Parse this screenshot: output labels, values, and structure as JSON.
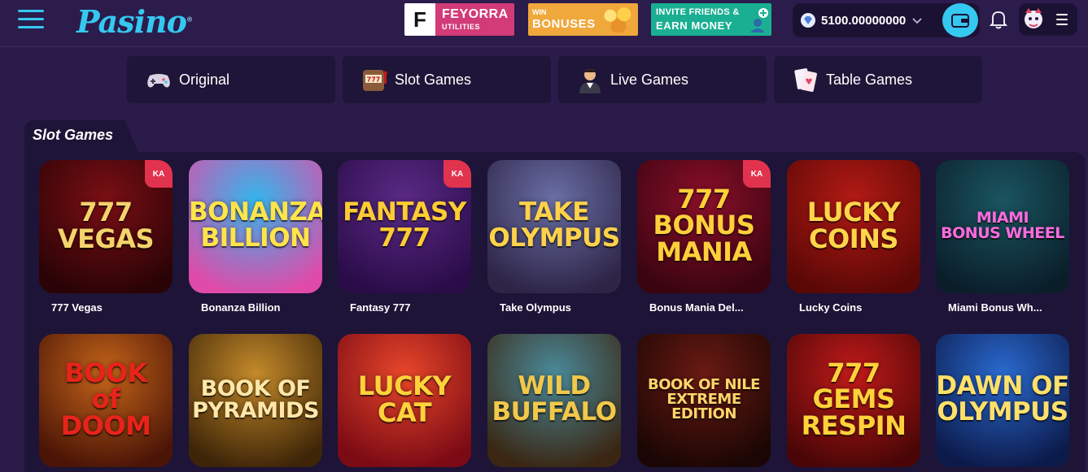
{
  "brand": {
    "logo": "Pasino"
  },
  "promos": {
    "feyorra": {
      "title": "FEYORRA",
      "subtitle": "UTILITIES"
    },
    "bonus": {
      "small": "WIN",
      "big": "BONUSES"
    },
    "invite": {
      "small": "INVITE FRIENDS &",
      "big": "EARN MONEY"
    }
  },
  "wallet": {
    "balance": "5100.00000000"
  },
  "categories": [
    {
      "label": "Original",
      "icon": "gamepad-icon"
    },
    {
      "label": "Slot Games",
      "icon": "slot-machine-icon"
    },
    {
      "label": "Live Games",
      "icon": "dealer-icon"
    },
    {
      "label": "Table Games",
      "icon": "cards-icon"
    }
  ],
  "section": {
    "title": "Slot Games"
  },
  "games": [
    {
      "name": "777 Vegas",
      "art": "777\nVEGAS",
      "colors": [
        "#7a0f14",
        "#2a0306"
      ],
      "text": "#f4d36b",
      "badge": true
    },
    {
      "name": "Bonanza Billion",
      "art": "BONANZA\nBILLION",
      "colors": [
        "#34b6ec",
        "#e04aa8"
      ],
      "text": "#ffe44a",
      "badge": false
    },
    {
      "name": "Fantasy 777",
      "art": "FANTASY\n777",
      "colors": [
        "#5a2a86",
        "#2a0c48"
      ],
      "text": "#ffcc33",
      "badge": true
    },
    {
      "name": "Take Olympus",
      "art": "TAKE\nOLYMPUS",
      "colors": [
        "#6a6fa6",
        "#2d2446"
      ],
      "text": "#ffd24a",
      "badge": false
    },
    {
      "name": "Bonus Mania Del...",
      "art": "777\nBONUS\nMANIA",
      "colors": [
        "#8a0f2a",
        "#3a0410"
      ],
      "text": "#ffcf3a",
      "badge": true
    },
    {
      "name": "Lucky Coins",
      "art": "LUCKY\nCOINS",
      "colors": [
        "#b31a14",
        "#5a0806"
      ],
      "text": "#ffd54a",
      "badge": false
    },
    {
      "name": "Miami Bonus Wh...",
      "art": "MIAMI\nBONUS WHEEL",
      "colors": [
        "#1a5560",
        "#0a1e2a"
      ],
      "text": "#ff6adf",
      "badge": false
    },
    {
      "name": "Book of Doom",
      "art": "BOOK\nof\nDOOM",
      "colors": [
        "#c4641a",
        "#4a1406"
      ],
      "text": "#e8231a",
      "badge": false
    },
    {
      "name": "Book of Pyramids",
      "art": "BOOK OF\nPYRAMIDS",
      "colors": [
        "#c48a2a",
        "#3e2508"
      ],
      "text": "#ffe7a8",
      "badge": false
    },
    {
      "name": "Lucky Cat",
      "art": "LUCKY\nCAT",
      "colors": [
        "#e8462a",
        "#7a0a14"
      ],
      "text": "#ffd23a",
      "badge": false
    },
    {
      "name": "Wild Buffalo",
      "art": "WILD\nBUFFALO",
      "colors": [
        "#4a8a9a",
        "#3a2612"
      ],
      "text": "#f2c84a",
      "badge": false
    },
    {
      "name": "Book of Nile",
      "art": "BOOK OF NILE\nEXTREME\nEDITION",
      "colors": [
        "#6a1a12",
        "#1a0604"
      ],
      "text": "#ffd56a",
      "badge": false
    },
    {
      "name": "777 Gems Respin",
      "art": "777\nGEMS\nRESPIN",
      "colors": [
        "#c21a1a",
        "#4a0606"
      ],
      "text": "#ffd23a",
      "badge": false
    },
    {
      "name": "Dawn of Olympus",
      "art": "DAWN OF\nOLYMPUS",
      "colors": [
        "#2a6ad0",
        "#0c1a4a"
      ],
      "text": "#ffe06a",
      "badge": false
    }
  ],
  "kiosk_badge": "KA"
}
